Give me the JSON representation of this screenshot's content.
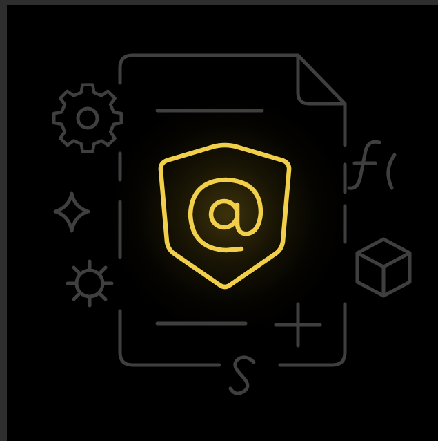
{
  "colors": {
    "frame": "#2e2e2e",
    "background": "#000000",
    "line_art": "#3f3f3f",
    "accent": "#f2cf4a"
  },
  "icons": [
    "document-icon",
    "shield-icon",
    "at-sign-icon",
    "gear-icon",
    "sparkle-icon",
    "sun-gear-icon",
    "function-icon",
    "cube-icon",
    "plus-icon",
    "dollar-s-icon"
  ]
}
